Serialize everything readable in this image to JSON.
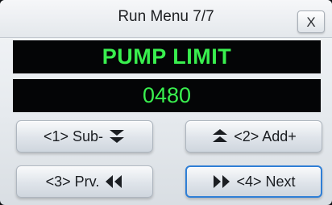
{
  "window": {
    "title": "Run Menu 7/7",
    "close_label": "X"
  },
  "display": {
    "parameter_name": "PUMP LIMIT",
    "parameter_value": "0480",
    "text_color": "#39ef4e",
    "background_color": "#040506"
  },
  "buttons": {
    "sub": {
      "label": "<1> Sub-",
      "icon": "double-chevron-down-icon"
    },
    "add": {
      "label": "<2> Add+",
      "icon": "double-chevron-up-icon"
    },
    "prev": {
      "label": "<3> Prv.",
      "icon": "double-arrow-left-icon"
    },
    "next": {
      "label": "<4> Next",
      "icon": "double-arrow-right-icon",
      "focused": true
    }
  },
  "colors": {
    "focus_border": "#2f7fd6"
  }
}
